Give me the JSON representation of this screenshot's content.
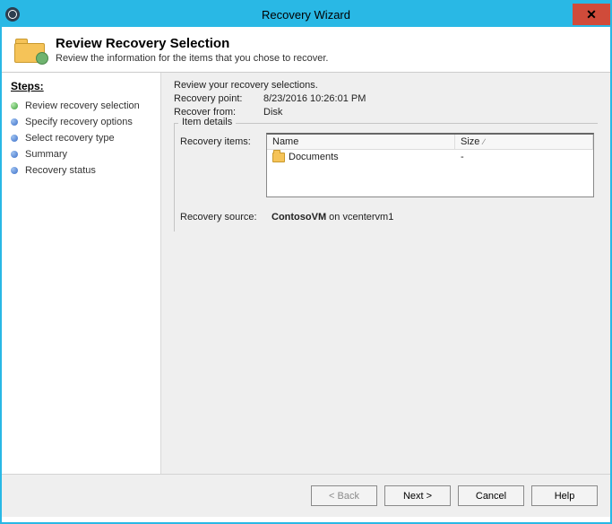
{
  "window": {
    "title": "Recovery Wizard"
  },
  "header": {
    "title": "Review Recovery Selection",
    "subtitle": "Review the information for the items that you chose to recover."
  },
  "sidebar": {
    "heading": "Steps:",
    "steps": [
      {
        "label": "Review recovery selection",
        "current": true
      },
      {
        "label": "Specify recovery options",
        "current": false
      },
      {
        "label": "Select recovery type",
        "current": false
      },
      {
        "label": "Summary",
        "current": false
      },
      {
        "label": "Recovery status",
        "current": false
      }
    ]
  },
  "main": {
    "intro": "Review your recovery selections.",
    "recovery_point_label": "Recovery point:",
    "recovery_point_value": "8/23/2016 10:26:01 PM",
    "recover_from_label": "Recover from:",
    "recover_from_value": "Disk",
    "item_details_legend": "Item details",
    "recovery_items_label": "Recovery items:",
    "columns": {
      "name": "Name",
      "size": "Size"
    },
    "rows": [
      {
        "name": "Documents",
        "size": "-"
      }
    ],
    "recovery_source_label": "Recovery source:",
    "recovery_source_bold": "ContosoVM",
    "recovery_source_rest": " on vcentervm1"
  },
  "footer": {
    "back": "< Back",
    "next": "Next >",
    "cancel": "Cancel",
    "help": "Help"
  }
}
